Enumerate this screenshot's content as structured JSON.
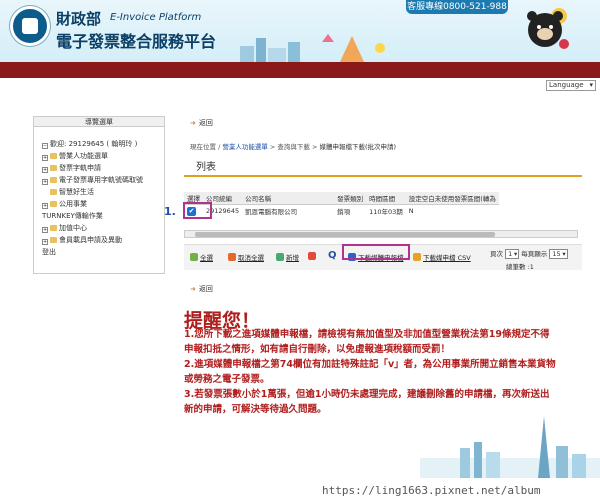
{
  "header": {
    "agency": "財政部",
    "platform_en": "E-Invoice Platform",
    "platform_zh": "電子發票整合服務平台",
    "hotline": "客服專線0800-521-988"
  },
  "language": {
    "label": "Language"
  },
  "nav": {
    "heading": "導覽選單",
    "user": "歡迎: 29129645 ( 翰明玲 )",
    "items": [
      "營業人功能選單",
      "發票字軌申請",
      "電子發票專用字軌號碼取號",
      "智慧好生活",
      "公用事業",
      "TURNKEY傳輸作業",
      "加值中心",
      "會員載具申請及異動",
      "登出"
    ]
  },
  "back_label": "返回",
  "breadcrumb": {
    "prefix": "現在位置 / ",
    "link1": "營業人功能選單",
    "link2": "查詢與下載",
    "current": "媒體申報檔下載(批次申請)"
  },
  "list": {
    "title": "列表",
    "columns": [
      "選擇",
      "公司統編",
      "公司名稱",
      "發票類別",
      "時間區間",
      "設定空白未使用發票區間(轉為"
    ],
    "rows": [
      {
        "id": "29129645",
        "name": "凱恩電腦有限公司",
        "type": "銷項",
        "period": "110年03期",
        "setting": "N"
      }
    ]
  },
  "step_marker": "1.",
  "toolbar": {
    "select_all": "全選",
    "cancel_all": "取消全選",
    "add": "新增",
    "delete": "",
    "download_media": "下載媒體申報檔",
    "download_csv": "下載媒申檔 CSV",
    "page_prefix": "頁次",
    "page_value": "1",
    "per_page_prefix": "每頁顯示",
    "per_page_value": "15",
    "total": "總筆數 :1"
  },
  "reminder": {
    "title": "提醒您！",
    "lines": [
      "1.您所下載之進項媒體申報檔，請檢視有無加值型及非加值型營業稅法第19條規定不得",
      "申報扣抵之情形，如有請自行刪除，以免虛報進項稅額而受罰！",
      "2.進項媒體申報檔之第74欄位有加註特殊註記「v」者，為公用事業所開立銷售本業貨物",
      "或勞務之電子發票。",
      "3.若發票張數小於1萬張，但逾1小時仍未處理完成，建議刪除舊的申請檔，再次新送出",
      "新的申請，可解決等待過久問題。"
    ]
  },
  "watermark": "https://ling1663.pixnet.net/album"
}
